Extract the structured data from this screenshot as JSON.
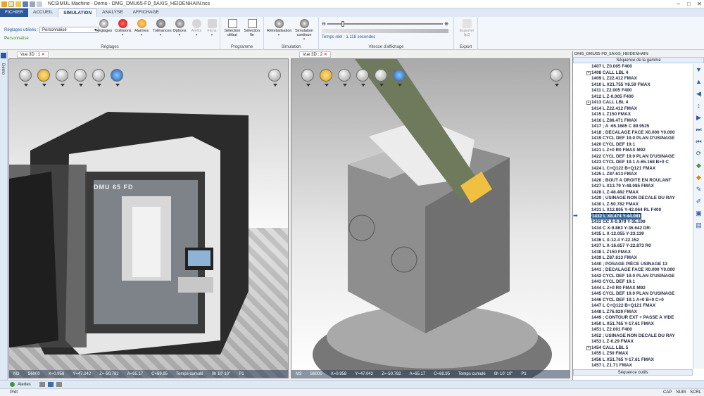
{
  "window": {
    "title": "NCSIMUL Machine - Demo - DMG_DMU65-FD_5AXIS_HEIDENHAIN.ncs"
  },
  "ribbon": {
    "tabs": [
      "FICHIER",
      "ACCUEIL",
      "SIMULATION",
      "ANALYSE",
      "AFFICHAGE"
    ],
    "reglages_label": "Réglages utilisés :",
    "reglages_value": "Personnalisé",
    "personnalise": "Personnalisé",
    "groups": {
      "reglages": "Réglages",
      "programme": "Programme",
      "simulation": "Simulation",
      "vitesse": "Vitesse d'affichage",
      "export": "Export"
    },
    "buttons": {
      "reglages": "Réglages",
      "collisions": "Collisions",
      "alarmes": "Alarmes",
      "tolerances": "Tolérances",
      "options": "Options",
      "arrets": "Arrêts",
      "films": "Films",
      "sel_debut": "Sélection début",
      "sel_fin": "Sélection fin",
      "reinit": "Réinitialisation",
      "sim_continue": "Simulation continue",
      "exporter": "Exporter ilp3"
    },
    "temps_reel": "Temps réel : 1.118 secondes"
  },
  "rail": {
    "label": "Demo"
  },
  "views": [
    {
      "tab": "Vue 3D : 1",
      "status": [
        "M3",
        "S6000",
        "X=0.958",
        "Y=47.042",
        "Z=-50.782",
        "A=65.17",
        "C=69.95",
        "Temps cumulé",
        "0h 10' 10\"",
        "P1"
      ]
    },
    {
      "tab": "Vue 3D : 2",
      "status": [
        "M3",
        "S6000",
        "X=0.958",
        "Y=47.042",
        "Z=-50.782",
        "A=65.17",
        "C=69.95",
        "Temps cumulé",
        "0h 10' 10\"",
        "P1"
      ]
    }
  ],
  "machine_label": "DMU 65 FD",
  "program": {
    "file": "DMG_DMU65-FD_5AXIS_HEIDENHAIN",
    "header": "Séquence de la gamme",
    "footer": "Séquence outils",
    "lines": [
      "1407 L Z0.005 F400",
      "1408 CALL LBL 4",
      "1409 L Z22.412 FMAX",
      "1410 L X21.755 Y8.59 FMAX",
      "1411 L Z2.005 F400",
      "1412 L Z-0.005 F400",
      "1413 CALL LBL 4",
      "1414 L Z22.412 FMAX",
      "1415 L Z150 FMAX",
      "1416 L Z86.471 FMAX",
      "1417 ;  A -65.1685  C 89.9525",
      "1418 ; DECALAGE FACE X0.000 Y0.000",
      "1419 CYCL DEF 19.0 PLAN D'USINAGE",
      "1420 CYCL DEF 19.1",
      "1421 L Z+0 R0 FMAX M92",
      "1422 CYCL DEF 19.0 PLAN D'USINAGE",
      "1423 CYCL DEF 19.1 A-65.168 B+0 C",
      "1424 L C+Q122 B+Q121 FMAX",
      "1425 L Z87.613 FMAX",
      "1426 ; BOUT A DROITE EN ROULANT",
      "1427 L X13.79 Y-48.085 FMAX",
      "1428 L Z-48.482 FMAX",
      "1429 ; USINAGE NON DECALE DU RAY",
      "1430 L Z-50.782 FMAX",
      "1431 L X12.805 Y-42.064 RL F400",
      "1432 L X8.474 Y-44.081",
      "1433 CC X-0.979 Y-35.199",
      "1434 C X-9.863 Y-36.642 DR-",
      "1435 L X-12.055 Y-23.139",
      "1436 L X-12.4 Y-22.152",
      "1437 L X-16.657 Y-22.873 R0",
      "1438 L Z150 FMAX",
      "1439 L Z87.613 FMAX",
      "1440 ; POSAGE PIÈCE USINAGE 13",
      "1441 ; DECALAGE FACE X0.000 Y0.000",
      "1442 CYCL DEF 19.0 PLAN D'USINAGE",
      "1443 CYCL DEF 19.1",
      "1444 L Z+0 R0 FMAX M92",
      "1445 CYCL DEF 19.0 PLAN D'USINAGE",
      "1446 CYCL DEF 19.1 A+0 B+0 C+0",
      "1447 L C+Q122 B+Q121 FMAX",
      "1448 L Z76.929 FMAX",
      "1449 ; CONTOUR EXT + PASSE A VIDE",
      "1450 L X51.765 Y-17.61 FMAX",
      "1451 L Z2.001 F400",
      "1452 ; USINAGE NON DECALE DU RAY",
      "1453 L Z-0.29 FMAX",
      "1454 CALL LBL 5",
      "1455 L Z50 FMAX",
      "1456 L X51.765 Y-17.61 FMAX",
      "1457 L Z1.71 FMAX"
    ],
    "selected_index": 25,
    "expandable": [
      1,
      6,
      47
    ]
  },
  "bottom": {
    "alerts": "Alertes",
    "status": "Prêt",
    "indicators": [
      "CAP",
      "NUM",
      "SCRL"
    ]
  }
}
